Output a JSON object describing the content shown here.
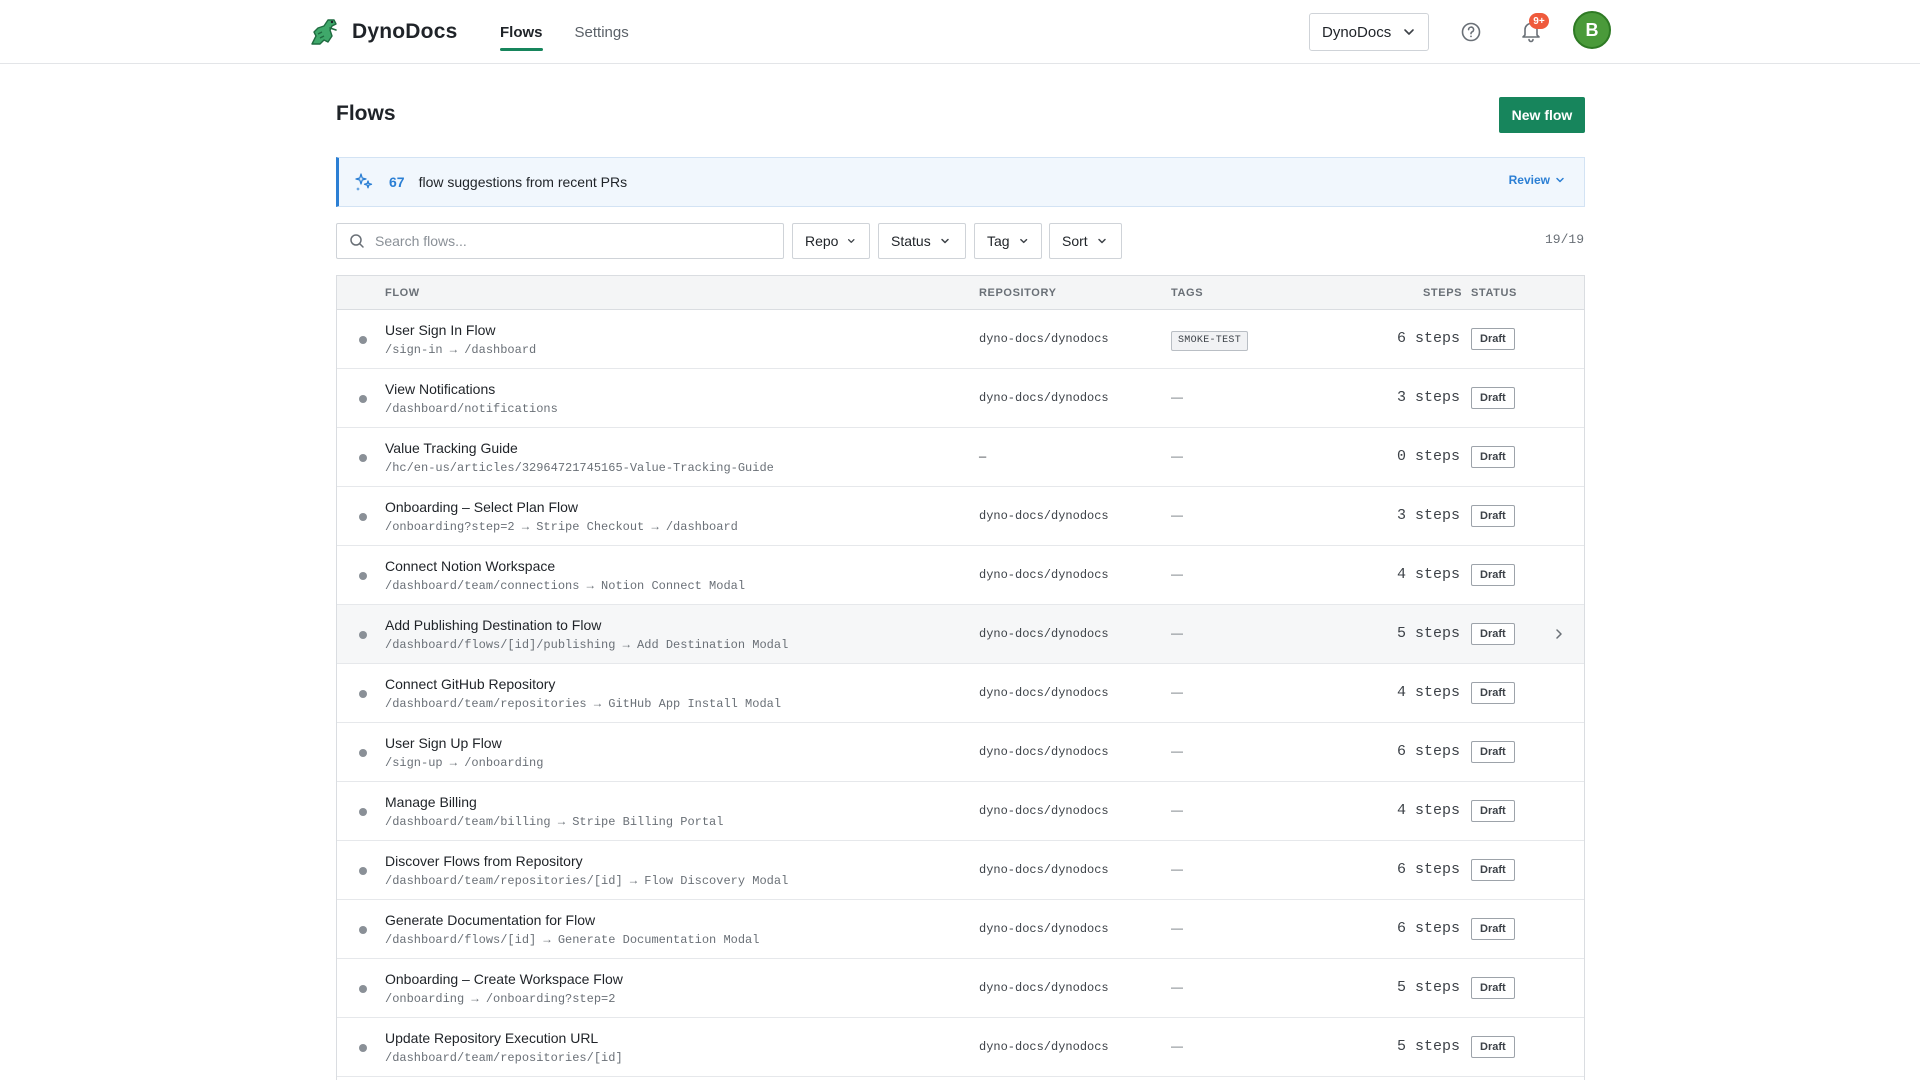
{
  "app": {
    "name": "DynoDocs"
  },
  "nav": {
    "tabs": [
      {
        "label": "Flows"
      },
      {
        "label": "Settings"
      }
    ]
  },
  "header": {
    "workspace": "DynoDocs",
    "notifications_badge": "9+",
    "avatar_initial": "B"
  },
  "page": {
    "title": "Flows",
    "new_button": "New flow"
  },
  "banner": {
    "count": "67",
    "text": "flow suggestions from recent PRs",
    "action": "Review"
  },
  "filters": {
    "search_placeholder": "Search flows...",
    "repo": "Repo",
    "status": "Status",
    "tag": "Tag",
    "sort": "Sort",
    "count": "19/19"
  },
  "table": {
    "columns": {
      "flow": "FLOW",
      "repository": "REPOSITORY",
      "tags": "TAGS",
      "steps": "STEPS",
      "status": "STATUS"
    },
    "rows": [
      {
        "name": "User Sign In Flow",
        "path": "/sign-in → /dashboard",
        "repo": "dyno-docs/dynodocs",
        "tag": "SMOKE-TEST",
        "steps": "6 steps",
        "status": "Draft"
      },
      {
        "name": "View Notifications",
        "path": "/dashboard/notifications",
        "repo": "dyno-docs/dynodocs",
        "tag": "—",
        "steps": "3 steps",
        "status": "Draft"
      },
      {
        "name": "Value Tracking Guide",
        "path": "/hc/en-us/articles/32964721745165-Value-Tracking-Guide",
        "repo": "—",
        "tag": "—",
        "steps": "0 steps",
        "status": "Draft"
      },
      {
        "name": "Onboarding – Select Plan Flow",
        "path": "/onboarding?step=2 → Stripe Checkout → /dashboard",
        "repo": "dyno-docs/dynodocs",
        "tag": "—",
        "steps": "3 steps",
        "status": "Draft"
      },
      {
        "name": "Connect Notion Workspace",
        "path": "/dashboard/team/connections → Notion Connect Modal",
        "repo": "dyno-docs/dynodocs",
        "tag": "—",
        "steps": "4 steps",
        "status": "Draft"
      },
      {
        "name": "Add Publishing Destination to Flow",
        "path": "/dashboard/flows/[id]/publishing → Add Destination Modal",
        "repo": "dyno-docs/dynodocs",
        "tag": "—",
        "steps": "5 steps",
        "status": "Draft"
      },
      {
        "name": "Connect GitHub Repository",
        "path": "/dashboard/team/repositories → GitHub App Install Modal",
        "repo": "dyno-docs/dynodocs",
        "tag": "—",
        "steps": "4 steps",
        "status": "Draft"
      },
      {
        "name": "User Sign Up Flow",
        "path": "/sign-up → /onboarding",
        "repo": "dyno-docs/dynodocs",
        "tag": "—",
        "steps": "6 steps",
        "status": "Draft"
      },
      {
        "name": "Manage Billing",
        "path": "/dashboard/team/billing → Stripe Billing Portal",
        "repo": "dyno-docs/dynodocs",
        "tag": "—",
        "steps": "4 steps",
        "status": "Draft"
      },
      {
        "name": "Discover Flows from Repository",
        "path": "/dashboard/team/repositories/[id] → Flow Discovery Modal",
        "repo": "dyno-docs/dynodocs",
        "tag": "—",
        "steps": "6 steps",
        "status": "Draft"
      },
      {
        "name": "Generate Documentation for Flow",
        "path": "/dashboard/flows/[id] → Generate Documentation Modal",
        "repo": "dyno-docs/dynodocs",
        "tag": "—",
        "steps": "6 steps",
        "status": "Draft"
      },
      {
        "name": "Onboarding – Create Workspace Flow",
        "path": "/onboarding → /onboarding?step=2",
        "repo": "dyno-docs/dynodocs",
        "tag": "—",
        "steps": "5 steps",
        "status": "Draft"
      },
      {
        "name": "Update Repository Execution URL",
        "path": "/dashboard/team/repositories/[id]",
        "repo": "dyno-docs/dynodocs",
        "tag": "—",
        "steps": "5 steps",
        "status": "Draft"
      }
    ]
  },
  "colors": {
    "accent": "#17855c",
    "info": "#2b7fd4",
    "badge": "#ef5a3c",
    "avatar": "#4a9a3a"
  },
  "icons": {
    "logo": "dino-logo-icon",
    "help": "help-circle-icon",
    "bell": "bell-icon",
    "chevron": "chevron-down-icon",
    "search": "search-icon",
    "sparkle": "sparkle-icon",
    "row_chevron": "chevron-right-icon"
  }
}
